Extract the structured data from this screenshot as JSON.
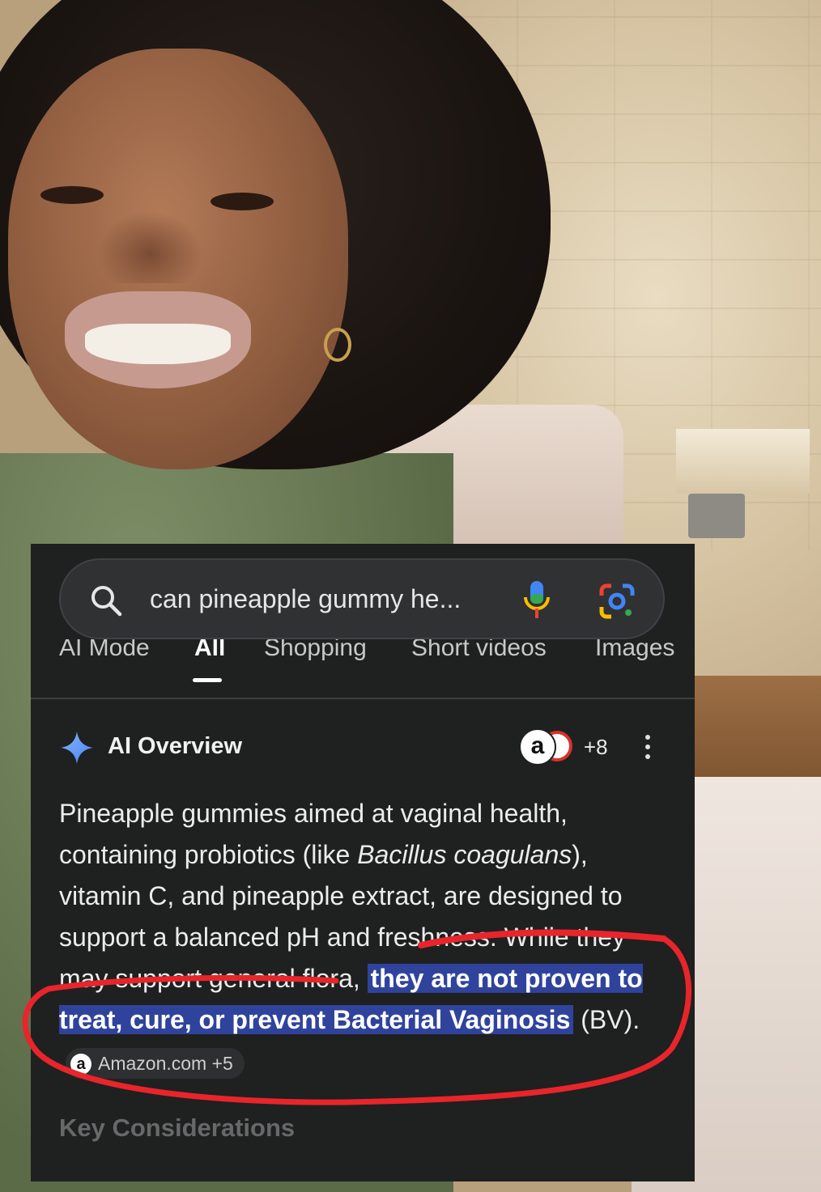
{
  "search": {
    "query": "can pineapple gummy he..."
  },
  "tabs": [
    {
      "label": "AI Mode"
    },
    {
      "label": "All"
    },
    {
      "label": "Shopping"
    },
    {
      "label": "Short videos"
    },
    {
      "label": "Images"
    }
  ],
  "ai_overview": {
    "title": "AI Overview",
    "badge_letter": "a",
    "more_sources": "+8",
    "text_1": "Pineapple gummies aimed at vaginal health, containing probiotics (like ",
    "text_italic": "Bacillus coagulans",
    "text_2": "), vitamin C, and pineapple extract, are designed to support a balanced pH and freshness. While they may support general flora, ",
    "highlight": "they are not proven to treat, cure, or prevent Bacterial Vaginosis",
    "text_3": " (BV).",
    "citation": {
      "icon_letter": "a",
      "label": "Amazon.com +5"
    },
    "next_heading": "Key Considerations"
  },
  "colors": {
    "panel_bg": "#1f2020",
    "highlight_bg": "#30439c",
    "annotation": "#e8252a"
  }
}
